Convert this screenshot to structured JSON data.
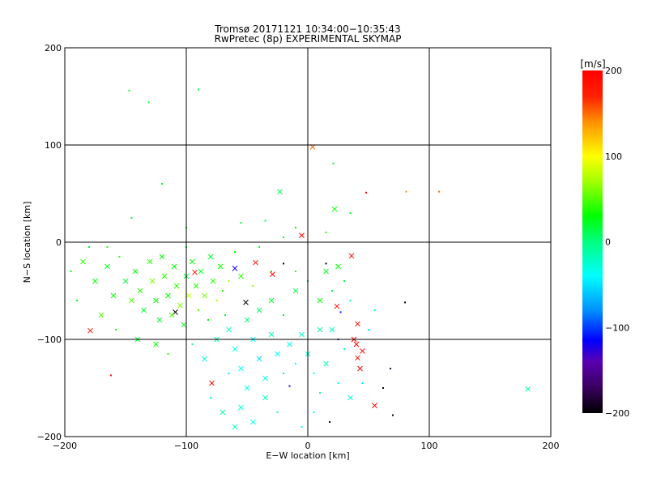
{
  "chart_data": {
    "type": "scatter",
    "title": "Tromsø 20171121 10:34:00−10:35:43",
    "subtitle": "RwPretec (8p) EXPERIMENTAL SKYMAP",
    "xlabel": "E−W location [km]",
    "ylabel": "N−S location [km]",
    "xlim": [
      -200,
      200
    ],
    "ylim": [
      -200,
      200
    ],
    "xticks": [
      -200,
      -100,
      0,
      100,
      200
    ],
    "yticks": [
      -200,
      -100,
      0,
      100,
      200
    ],
    "xtick_labels": [
      "−200",
      "−100",
      "0",
      "100",
      "200"
    ],
    "ytick_labels": [
      "−200",
      "−100",
      "0",
      "100",
      "200"
    ],
    "grid": true,
    "colorbar": {
      "label": "[m/s]",
      "range": [
        -200,
        200
      ],
      "ticks": [
        200,
        100,
        0,
        -100,
        -200
      ],
      "tick_labels": [
        "200",
        "100",
        "0",
        "−100",
        "−200"
      ],
      "position": "right",
      "stops": [
        [
          -200,
          "#000000"
        ],
        [
          -170,
          "#3a0060"
        ],
        [
          -140,
          "#5a00b0"
        ],
        [
          -115,
          "#0000ff"
        ],
        [
          -80,
          "#0090ff"
        ],
        [
          -40,
          "#00ffff"
        ],
        [
          0,
          "#00ff80"
        ],
        [
          30,
          "#00ff00"
        ],
        [
          70,
          "#a0ff00"
        ],
        [
          100,
          "#ffff00"
        ],
        [
          140,
          "#ff9000"
        ],
        [
          170,
          "#ff2000"
        ],
        [
          200,
          "#ff0000"
        ]
      ]
    },
    "points_format": [
      "x_km",
      "y_km",
      "velocity_m_s",
      "large_marker"
    ],
    "points": [
      [
        -147,
        156,
        20,
        0
      ],
      [
        -131,
        144,
        15,
        0
      ],
      [
        -90,
        157,
        20,
        0
      ],
      [
        21,
        81,
        25,
        0
      ],
      [
        81,
        52,
        140,
        0
      ],
      [
        108,
        52,
        150,
        0
      ],
      [
        48,
        51,
        190,
        0
      ],
      [
        4,
        98,
        150,
        1
      ],
      [
        -23,
        52,
        10,
        1
      ],
      [
        22,
        34,
        30,
        1
      ],
      [
        181,
        -151,
        -10,
        1
      ],
      [
        -5,
        7,
        200,
        1
      ],
      [
        -43,
        -21,
        190,
        1
      ],
      [
        -29,
        -33,
        200,
        1
      ],
      [
        36,
        -14,
        200,
        1
      ],
      [
        24,
        -66,
        190,
        1
      ],
      [
        41,
        -84,
        200,
        1
      ],
      [
        40,
        -105,
        200,
        1
      ],
      [
        41,
        -119,
        190,
        1
      ],
      [
        43,
        -130,
        200,
        1
      ],
      [
        38,
        -100,
        200,
        1
      ],
      [
        45,
        -112,
        190,
        1
      ],
      [
        55,
        -168,
        200,
        1
      ],
      [
        -179,
        -91,
        180,
        1
      ],
      [
        -93,
        -31,
        190,
        1
      ],
      [
        -79,
        -145,
        190,
        1
      ],
      [
        -60,
        -27,
        -120,
        1
      ],
      [
        27,
        -72,
        -110,
        0
      ],
      [
        -51,
        -62,
        -200,
        1
      ],
      [
        -109,
        -72,
        -200,
        1
      ],
      [
        -162,
        -137,
        190,
        0
      ],
      [
        62,
        -150,
        -200,
        0
      ],
      [
        70,
        -178,
        -200,
        0
      ],
      [
        18,
        -185,
        -200,
        0
      ],
      [
        -20,
        -22,
        -200,
        0
      ],
      [
        15,
        -22,
        -200,
        0
      ],
      [
        80,
        -62,
        -190,
        0
      ],
      [
        68,
        -130,
        -180,
        0
      ],
      [
        -15,
        -148,
        -120,
        0
      ],
      [
        25,
        -100,
        -110,
        0
      ],
      [
        -185,
        -20,
        40,
        1
      ],
      [
        -175,
        -40,
        30,
        1
      ],
      [
        -165,
        -25,
        20,
        1
      ],
      [
        -160,
        -55,
        30,
        1
      ],
      [
        -155,
        -15,
        40,
        0
      ],
      [
        -150,
        -40,
        20,
        1
      ],
      [
        -145,
        -60,
        50,
        1
      ],
      [
        -142,
        -30,
        30,
        1
      ],
      [
        -138,
        -50,
        40,
        1
      ],
      [
        -135,
        -70,
        20,
        1
      ],
      [
        -130,
        -20,
        40,
        1
      ],
      [
        -128,
        -40,
        60,
        1
      ],
      [
        -125,
        -60,
        30,
        1
      ],
      [
        -122,
        -80,
        20,
        1
      ],
      [
        -120,
        -15,
        30,
        1
      ],
      [
        -118,
        -35,
        40,
        1
      ],
      [
        -115,
        -55,
        30,
        1
      ],
      [
        -112,
        -75,
        50,
        1
      ],
      [
        -110,
        -25,
        30,
        1
      ],
      [
        -108,
        -45,
        40,
        1
      ],
      [
        -105,
        -65,
        60,
        1
      ],
      [
        -102,
        -85,
        20,
        1
      ],
      [
        -100,
        -35,
        20,
        1
      ],
      [
        -98,
        -55,
        80,
        1
      ],
      [
        -95,
        -20,
        30,
        1
      ],
      [
        -92,
        -45,
        40,
        1
      ],
      [
        -90,
        -70,
        50,
        0
      ],
      [
        -88,
        -30,
        20,
        1
      ],
      [
        -85,
        -55,
        60,
        1
      ],
      [
        -82,
        -80,
        30,
        0
      ],
      [
        -80,
        -15,
        20,
        1
      ],
      [
        -78,
        -40,
        40,
        1
      ],
      [
        -75,
        -60,
        70,
        0
      ],
      [
        -72,
        -25,
        30,
        1
      ],
      [
        -70,
        -50,
        40,
        0
      ],
      [
        -68,
        -75,
        20,
        0
      ],
      [
        -190,
        -60,
        30,
        0
      ],
      [
        -170,
        -75,
        50,
        1
      ],
      [
        -158,
        -90,
        30,
        0
      ],
      [
        -140,
        -100,
        20,
        1
      ],
      [
        -125,
        -105,
        30,
        1
      ],
      [
        -115,
        -115,
        40,
        0
      ],
      [
        -180,
        -5,
        20,
        0
      ],
      [
        -195,
        -30,
        30,
        0
      ],
      [
        -165,
        -5,
        40,
        0
      ],
      [
        -100,
        -5,
        20,
        0
      ],
      [
        -60,
        -10,
        30,
        0
      ],
      [
        -40,
        -5,
        20,
        0
      ],
      [
        -65,
        -90,
        -20,
        1
      ],
      [
        -60,
        -110,
        -30,
        1
      ],
      [
        -55,
        -130,
        -40,
        1
      ],
      [
        -50,
        -150,
        -30,
        1
      ],
      [
        -45,
        -100,
        -40,
        1
      ],
      [
        -40,
        -120,
        -50,
        1
      ],
      [
        -35,
        -140,
        -30,
        1
      ],
      [
        -30,
        -95,
        -20,
        1
      ],
      [
        -25,
        -115,
        -40,
        1
      ],
      [
        -20,
        -135,
        -50,
        0
      ],
      [
        -15,
        -105,
        -30,
        1
      ],
      [
        -10,
        -125,
        -40,
        0
      ],
      [
        -5,
        -95,
        -20,
        1
      ],
      [
        0,
        -115,
        -30,
        1
      ],
      [
        5,
        -135,
        -40,
        0
      ],
      [
        10,
        -90,
        -10,
        1
      ],
      [
        -55,
        -170,
        -30,
        1
      ],
      [
        -45,
        -185,
        -40,
        1
      ],
      [
        -35,
        -160,
        -20,
        1
      ],
      [
        -25,
        -175,
        -30,
        0
      ],
      [
        -70,
        -175,
        -10,
        1
      ],
      [
        -60,
        -190,
        -20,
        1
      ],
      [
        -80,
        -160,
        -40,
        0
      ],
      [
        -85,
        -120,
        -30,
        1
      ],
      [
        -95,
        -105,
        -20,
        0
      ],
      [
        -75,
        -100,
        -10,
        1
      ],
      [
        -65,
        -135,
        -50,
        0
      ],
      [
        -50,
        -80,
        0,
        1
      ],
      [
        -40,
        -70,
        10,
        1
      ],
      [
        -30,
        -60,
        20,
        1
      ],
      [
        -20,
        -75,
        30,
        0
      ],
      [
        -10,
        -50,
        10,
        1
      ],
      [
        0,
        -40,
        20,
        0
      ],
      [
        10,
        -60,
        30,
        1
      ],
      [
        15,
        -30,
        20,
        1
      ],
      [
        20,
        -50,
        10,
        0
      ],
      [
        25,
        -25,
        30,
        1
      ],
      [
        30,
        -40,
        20,
        0
      ],
      [
        35,
        -60,
        -10,
        0
      ],
      [
        20,
        -90,
        -20,
        1
      ],
      [
        30,
        -110,
        -30,
        0
      ],
      [
        15,
        -125,
        -20,
        1
      ],
      [
        25,
        -145,
        -40,
        0
      ],
      [
        35,
        -160,
        -30,
        1
      ],
      [
        10,
        -155,
        -20,
        0
      ],
      [
        5,
        -175,
        -30,
        0
      ],
      [
        -5,
        -190,
        -40,
        0
      ],
      [
        45,
        -145,
        -50,
        0
      ],
      [
        50,
        -90,
        -30,
        0
      ],
      [
        55,
        -70,
        -20,
        0
      ],
      [
        -10,
        -30,
        40,
        0
      ],
      [
        -30,
        -30,
        30,
        0
      ],
      [
        -45,
        -45,
        60,
        0
      ],
      [
        -55,
        -35,
        40,
        1
      ],
      [
        -65,
        -40,
        70,
        0
      ],
      [
        -20,
        5,
        20,
        0
      ],
      [
        -10,
        15,
        30,
        0
      ],
      [
        -35,
        22,
        10,
        0
      ],
      [
        -55,
        20,
        20,
        0
      ],
      [
        -100,
        15,
        30,
        0
      ],
      [
        -120,
        60,
        20,
        0
      ],
      [
        -145,
        25,
        20,
        0
      ],
      [
        35,
        30,
        20,
        0
      ],
      [
        15,
        10,
        40,
        0
      ]
    ]
  }
}
